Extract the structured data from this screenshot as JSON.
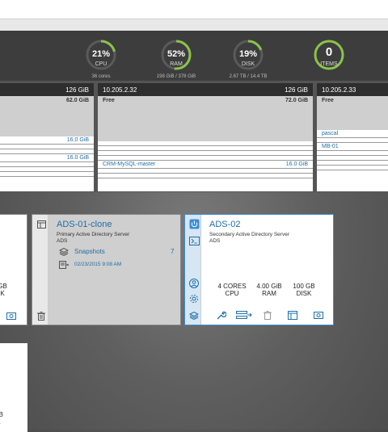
{
  "stats": {
    "cpu": {
      "pct": "21%",
      "label": "CPU",
      "sub": "36 cores",
      "fraction": 0.21
    },
    "ram": {
      "pct": "52%",
      "label": "RAM",
      "sub": "198 GiB / 378 GiB",
      "fraction": 0.52
    },
    "disk": {
      "pct": "19%",
      "label": "DISK",
      "sub": "2.67 TB / 14.4 TB",
      "fraction": 0.19
    },
    "items": {
      "value": "0",
      "label": "ITEMS"
    }
  },
  "colors": {
    "accent": "#8bc34a",
    "link": "#1e6fa8",
    "selected": "#3a8fd6"
  },
  "hosts": [
    {
      "size": "126 GiB",
      "free_value": "62.0 GiB",
      "vms": [
        {
          "name": "",
          "size": "16.0 GiB"
        },
        {
          "name": "",
          "size": "16.0 GiB"
        }
      ]
    },
    {
      "ip": "10.205.2.32",
      "size": "126 GiB",
      "free_label": "Free",
      "free_value": "72.0 GiB",
      "vms": [
        {
          "name": "CRM-MySQL-master",
          "size": "16.0 GiB"
        }
      ]
    },
    {
      "ip": "10.205.2.33",
      "free_label": "Free",
      "vms": [
        {
          "name": "pascal",
          "size": ""
        },
        {
          "name": "MB-01",
          "size": ""
        }
      ]
    }
  ],
  "left_card": {
    "disk_text": "GB",
    "disk_label": "K"
  },
  "clone_card": {
    "title": "ADS-01-clone",
    "desc1": "Primary Active Directory Server",
    "desc2": "ADS",
    "snapshots_label": "Snapshots",
    "snapshots_count": "7",
    "date": "02/23/2015 9:08 AM"
  },
  "ads02_card": {
    "title": "ADS-02",
    "desc1": "Secondary Active Directory Server",
    "desc2": "ADS",
    "cores_value": "4 CORES",
    "cores_label": "CPU",
    "ram_value": "4.00 GiB",
    "ram_label": "RAM",
    "disk_value": "100 GB",
    "disk_label": "DISK"
  },
  "bottom_left": {
    "text1": "GB",
    "text2": "K"
  }
}
